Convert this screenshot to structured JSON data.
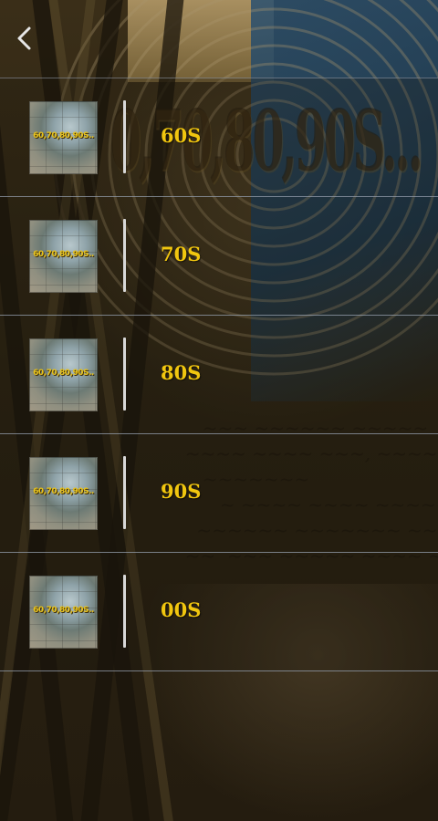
{
  "header": {
    "back_icon": "chevron-left-icon"
  },
  "background": {
    "overlay_title": "0,70,80,90S..."
  },
  "thumbnail_text": "60,70,80,90S..",
  "eras": [
    {
      "label": "60S"
    },
    {
      "label": "70S"
    },
    {
      "label": "80S"
    },
    {
      "label": "90S"
    },
    {
      "label": "00S"
    }
  ],
  "colors": {
    "accent": "#f1c60f",
    "divider": "#d8d8d8",
    "row_border": "#969fae"
  }
}
